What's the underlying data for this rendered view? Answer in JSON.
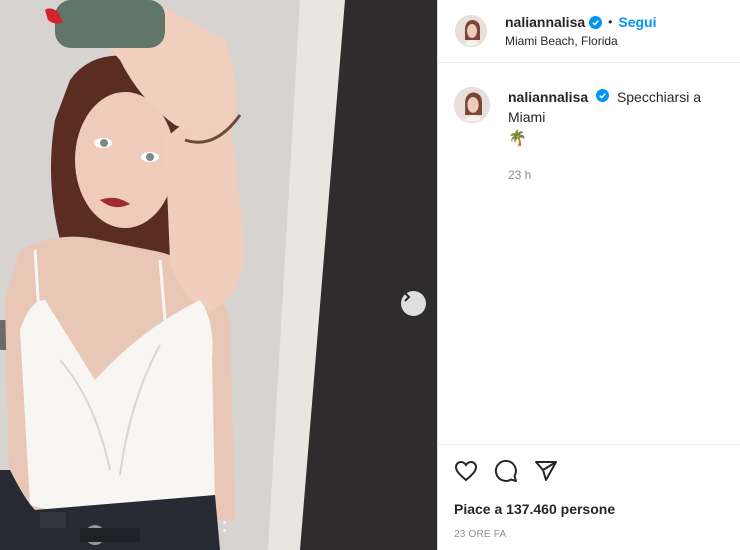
{
  "post": {
    "username": "naliannalisa",
    "separator": "•",
    "follow_label": "Segui",
    "location": "Miami Beach, Florida",
    "caption": "Specchiarsi a Miami",
    "caption_emoji": "🌴",
    "comment_time": "23 h",
    "likes_text": "Piace a 137.460 persone",
    "posted_ago": "23 ORE FA"
  },
  "icons": {
    "verified": "verified-badge-icon",
    "like": "heart-icon",
    "comment": "comment-icon",
    "share": "share-icon",
    "next": "chevron-right-icon"
  },
  "colors": {
    "accent": "#0095f6",
    "verified": "#0095f6",
    "muted": "#8e8e8e"
  }
}
